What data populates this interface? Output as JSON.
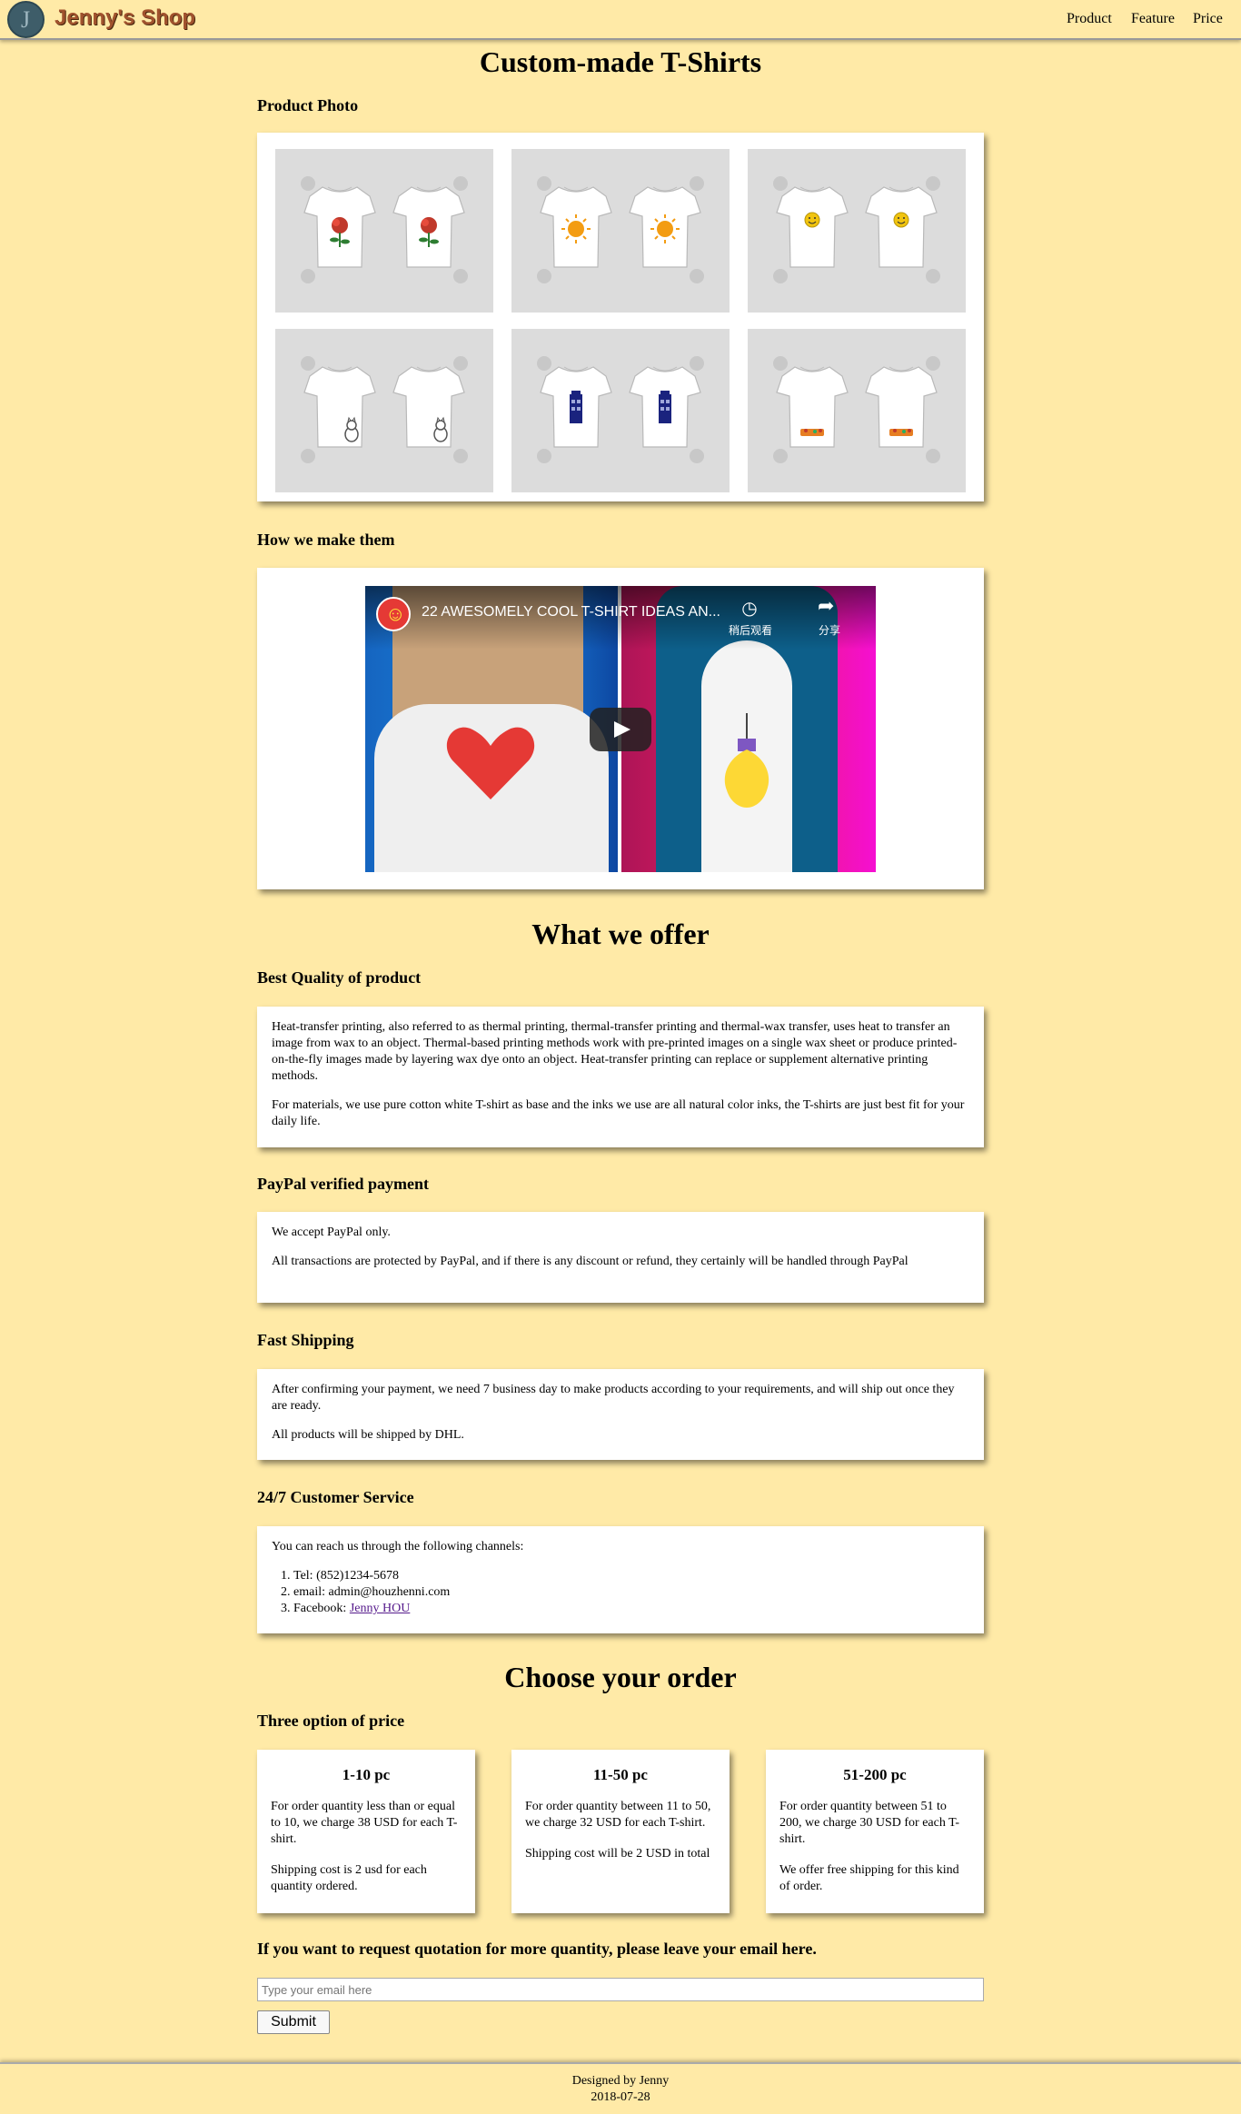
{
  "nav": {
    "logo_letter": "J",
    "brand": "Jenny's Shop",
    "links": [
      "Product",
      "Feature",
      "Price"
    ]
  },
  "page_title": "Custom-made T-Shirts",
  "product_photo": {
    "heading": "Product Photo",
    "items": [
      {
        "design": "rose-icon",
        "color": "#c0392b"
      },
      {
        "design": "sun-icon",
        "color": "#f39c12"
      },
      {
        "design": "smiley-icon",
        "color": "#f1c40f"
      },
      {
        "design": "cat-icon",
        "color": "#555555"
      },
      {
        "design": "police-box-icon",
        "color": "#1a237e"
      },
      {
        "design": "pizza-slice-icon",
        "color": "#e67e22"
      }
    ]
  },
  "how": {
    "heading": "How we make them",
    "video_title": "22 AWESOMELY COOL T-SHIRT IDEAS AN...",
    "watch_later": "稍后观看",
    "share": "分享"
  },
  "offer": {
    "heading": "What we offer",
    "sections": [
      {
        "title": "Best Quality of product",
        "paragraphs": [
          "Heat-transfer printing, also referred to as thermal printing, thermal-transfer printing and thermal-wax transfer, uses heat to transfer an image from wax to an object. Thermal-based printing methods work with pre-printed images on a single wax sheet or produce printed-on-the-fly images made by layering wax dye onto an object. Heat-transfer printing can replace or supplement alternative printing methods.",
          "For materials, we use pure cotton white T-shirt as base and the inks we use are all natural color inks, the T-shirts are just best fit for your daily life."
        ]
      },
      {
        "title": "PayPal verified payment",
        "paragraphs": [
          "We accept PayPal only.",
          "All transactions are protected by PayPal, and if there is any discount or refund, they certainly will be handled through PayPal"
        ]
      },
      {
        "title": "Fast Shipping",
        "paragraphs": [
          "After confirming your payment, we need 7 business day to make products according to your requirements, and will ship out once they are ready.",
          "All products will be shipped by DHL."
        ]
      }
    ],
    "service": {
      "title": "24/7 Customer Service",
      "intro": "You can reach us through the following channels:",
      "tel": "Tel: (852)1234-5678",
      "email": "email: admin@houzhenni.com",
      "facebook_prefix": "Facebook: ",
      "facebook_link": "Jenny HOU"
    }
  },
  "order": {
    "heading": "Choose your order",
    "subheading": "Three option of price",
    "options": [
      {
        "title": "1-10 pc",
        "desc": "For order quantity less than or equal to 10, we charge 38 USD for each T-shirt.",
        "shipping": "Shipping cost is 2 usd for each quantity ordered."
      },
      {
        "title": "11-50 pc",
        "desc": "For order quantity between 11 to 50, we charge 32 USD for each T-shirt.",
        "shipping": "Shipping cost will be 2 USD in total"
      },
      {
        "title": "51-200 pc",
        "desc": "For order quantity between 51 to 200, we charge 30 USD for each T-shirt.",
        "shipping": "We offer free shipping for this kind of order."
      }
    ],
    "quote_text": "If you want to request quotation for more quantity, please leave your email here.",
    "email_placeholder": "Type your email here",
    "submit_label": "Submit"
  },
  "footer": {
    "designer": "Designed by Jenny",
    "date": "2018-07-28"
  }
}
